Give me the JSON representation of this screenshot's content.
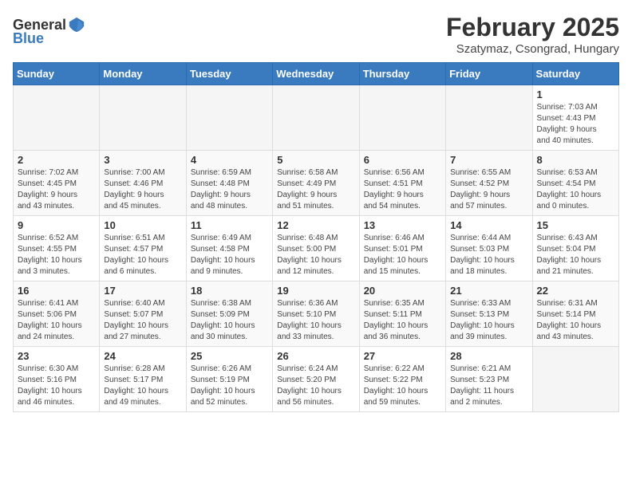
{
  "header": {
    "logo_general": "General",
    "logo_blue": "Blue",
    "month_title": "February 2025",
    "location": "Szatymaz, Csongrad, Hungary"
  },
  "days_of_week": [
    "Sunday",
    "Monday",
    "Tuesday",
    "Wednesday",
    "Thursday",
    "Friday",
    "Saturday"
  ],
  "weeks": [
    [
      {
        "day": "",
        "info": ""
      },
      {
        "day": "",
        "info": ""
      },
      {
        "day": "",
        "info": ""
      },
      {
        "day": "",
        "info": ""
      },
      {
        "day": "",
        "info": ""
      },
      {
        "day": "",
        "info": ""
      },
      {
        "day": "1",
        "info": "Sunrise: 7:03 AM\nSunset: 4:43 PM\nDaylight: 9 hours\nand 40 minutes."
      }
    ],
    [
      {
        "day": "2",
        "info": "Sunrise: 7:02 AM\nSunset: 4:45 PM\nDaylight: 9 hours\nand 43 minutes."
      },
      {
        "day": "3",
        "info": "Sunrise: 7:00 AM\nSunset: 4:46 PM\nDaylight: 9 hours\nand 45 minutes."
      },
      {
        "day": "4",
        "info": "Sunrise: 6:59 AM\nSunset: 4:48 PM\nDaylight: 9 hours\nand 48 minutes."
      },
      {
        "day": "5",
        "info": "Sunrise: 6:58 AM\nSunset: 4:49 PM\nDaylight: 9 hours\nand 51 minutes."
      },
      {
        "day": "6",
        "info": "Sunrise: 6:56 AM\nSunset: 4:51 PM\nDaylight: 9 hours\nand 54 minutes."
      },
      {
        "day": "7",
        "info": "Sunrise: 6:55 AM\nSunset: 4:52 PM\nDaylight: 9 hours\nand 57 minutes."
      },
      {
        "day": "8",
        "info": "Sunrise: 6:53 AM\nSunset: 4:54 PM\nDaylight: 10 hours\nand 0 minutes."
      }
    ],
    [
      {
        "day": "9",
        "info": "Sunrise: 6:52 AM\nSunset: 4:55 PM\nDaylight: 10 hours\nand 3 minutes."
      },
      {
        "day": "10",
        "info": "Sunrise: 6:51 AM\nSunset: 4:57 PM\nDaylight: 10 hours\nand 6 minutes."
      },
      {
        "day": "11",
        "info": "Sunrise: 6:49 AM\nSunset: 4:58 PM\nDaylight: 10 hours\nand 9 minutes."
      },
      {
        "day": "12",
        "info": "Sunrise: 6:48 AM\nSunset: 5:00 PM\nDaylight: 10 hours\nand 12 minutes."
      },
      {
        "day": "13",
        "info": "Sunrise: 6:46 AM\nSunset: 5:01 PM\nDaylight: 10 hours\nand 15 minutes."
      },
      {
        "day": "14",
        "info": "Sunrise: 6:44 AM\nSunset: 5:03 PM\nDaylight: 10 hours\nand 18 minutes."
      },
      {
        "day": "15",
        "info": "Sunrise: 6:43 AM\nSunset: 5:04 PM\nDaylight: 10 hours\nand 21 minutes."
      }
    ],
    [
      {
        "day": "16",
        "info": "Sunrise: 6:41 AM\nSunset: 5:06 PM\nDaylight: 10 hours\nand 24 minutes."
      },
      {
        "day": "17",
        "info": "Sunrise: 6:40 AM\nSunset: 5:07 PM\nDaylight: 10 hours\nand 27 minutes."
      },
      {
        "day": "18",
        "info": "Sunrise: 6:38 AM\nSunset: 5:09 PM\nDaylight: 10 hours\nand 30 minutes."
      },
      {
        "day": "19",
        "info": "Sunrise: 6:36 AM\nSunset: 5:10 PM\nDaylight: 10 hours\nand 33 minutes."
      },
      {
        "day": "20",
        "info": "Sunrise: 6:35 AM\nSunset: 5:11 PM\nDaylight: 10 hours\nand 36 minutes."
      },
      {
        "day": "21",
        "info": "Sunrise: 6:33 AM\nSunset: 5:13 PM\nDaylight: 10 hours\nand 39 minutes."
      },
      {
        "day": "22",
        "info": "Sunrise: 6:31 AM\nSunset: 5:14 PM\nDaylight: 10 hours\nand 43 minutes."
      }
    ],
    [
      {
        "day": "23",
        "info": "Sunrise: 6:30 AM\nSunset: 5:16 PM\nDaylight: 10 hours\nand 46 minutes."
      },
      {
        "day": "24",
        "info": "Sunrise: 6:28 AM\nSunset: 5:17 PM\nDaylight: 10 hours\nand 49 minutes."
      },
      {
        "day": "25",
        "info": "Sunrise: 6:26 AM\nSunset: 5:19 PM\nDaylight: 10 hours\nand 52 minutes."
      },
      {
        "day": "26",
        "info": "Sunrise: 6:24 AM\nSunset: 5:20 PM\nDaylight: 10 hours\nand 56 minutes."
      },
      {
        "day": "27",
        "info": "Sunrise: 6:22 AM\nSunset: 5:22 PM\nDaylight: 10 hours\nand 59 minutes."
      },
      {
        "day": "28",
        "info": "Sunrise: 6:21 AM\nSunset: 5:23 PM\nDaylight: 11 hours\nand 2 minutes."
      },
      {
        "day": "",
        "info": ""
      }
    ]
  ]
}
